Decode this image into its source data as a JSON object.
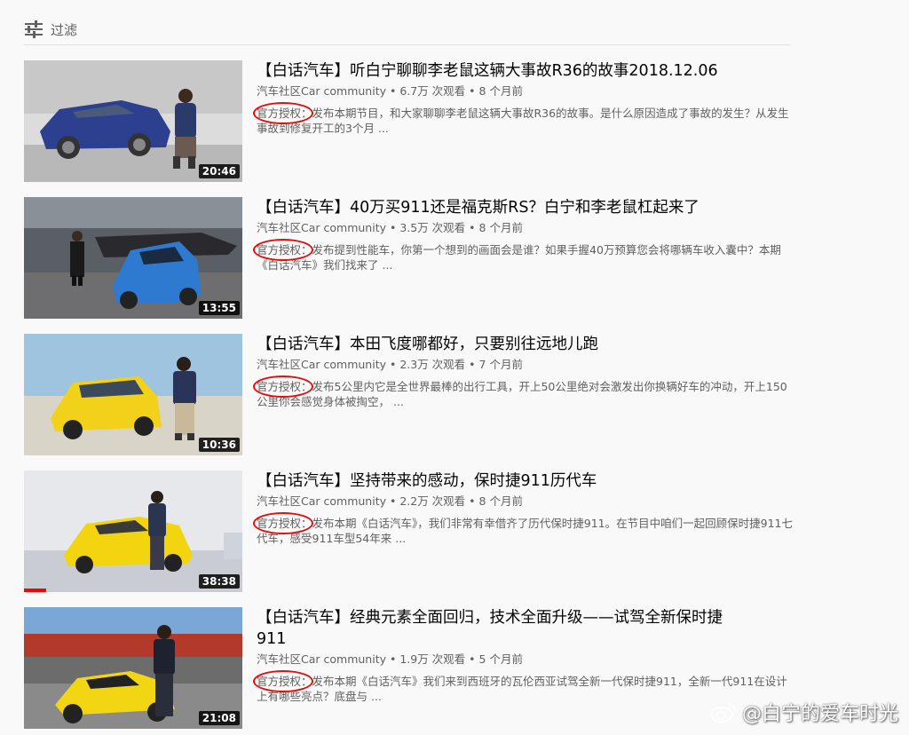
{
  "filter": {
    "label": "过滤",
    "icon": "sliders-icon"
  },
  "results": [
    {
      "title": "【白话汽车】听白宁聊聊李老鼠这辆大事故R36的故事2018.12.06",
      "channel": "汽车社区Car community",
      "views": "6.7万 次观看",
      "age": "8 个月前",
      "description": "官方授权：发布本期节目，和大家聊聊李老鼠这辆大事故R36的故事。是什么原因造成了事故的发生？从发生事故到修复开工的3个月 ...",
      "duration": "20:46"
    },
    {
      "title": "【白话汽车】40万买911还是福克斯RS？白宁和李老鼠杠起来了",
      "channel": "汽车社区Car community",
      "views": "3.5万 次观看",
      "age": "8 个月前",
      "description": "官方授权：发布提到性能车，你第一个想到的画面会是谁？如果手握40万预算您会将哪辆车收入囊中？本期《白话汽车》我们找来了 ...",
      "duration": "13:55"
    },
    {
      "title": "【白话汽车】本田飞度哪都好，只要别往远地儿跑",
      "channel": "汽车社区Car community",
      "views": "2.3万 次观看",
      "age": "7 个月前",
      "description": "官方授权：发布5公里内它是全世界最棒的出行工具，开上50公里绝对会激发出你换辆好车的冲动，开上150公里你会感觉身体被掏空，  ...",
      "duration": "10:36"
    },
    {
      "title": "【白话汽车】坚持带来的感动，保时捷911历代车",
      "channel": "汽车社区Car community",
      "views": "2.2万 次观看",
      "age": "8 个月前",
      "description": "官方授权：发布本期《白话汽车》，我们非常有幸借齐了历代保时捷911。在节目中咱们一起回顾保时捷911七代车，感受911车型54年来 ...",
      "duration": "38:38",
      "progress": 0.1
    },
    {
      "title": "【白话汽车】经典元素全面回归，技术全面升级——试驾全新保时捷911",
      "channel": "汽车社区Car community",
      "views": "1.9万 次观看",
      "age": "5 个月前",
      "description": "官方授权：发布本期《白话汽车》我们来到西班牙的瓦伦西亚试驾全新一代保时捷911，全新一代911在设计上有哪些亮点？底盘与 ...",
      "duration": "21:08"
    }
  ],
  "watermark": {
    "text": "@白宁的爱车时光",
    "icon": "weibo-icon"
  }
}
